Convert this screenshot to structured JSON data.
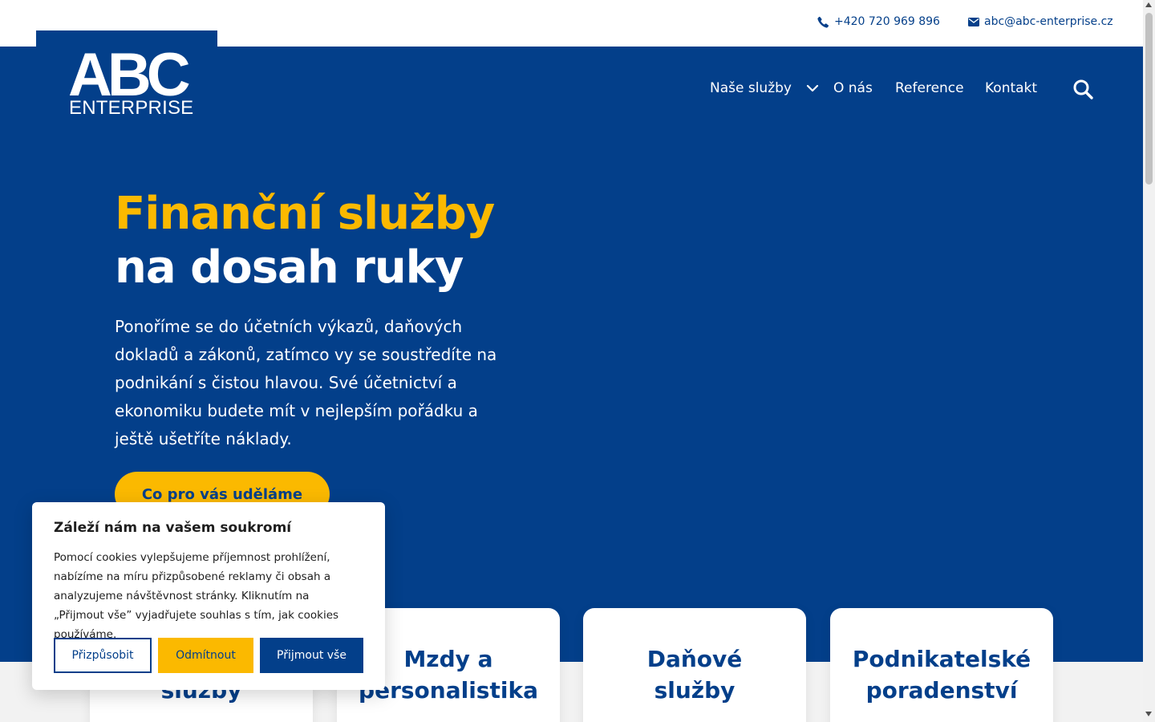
{
  "topbar": {
    "phone": "+420 720 969 896",
    "email": "abc@abc-enterprise.cz",
    "phone_icon": "phone-icon",
    "email_icon": "envelope-icon"
  },
  "logo": {
    "main": "ABC",
    "sub": "ENTERPRISE"
  },
  "nav": {
    "items": [
      {
        "label": "Naše služby",
        "has_dropdown": true
      },
      {
        "label": "O nás"
      },
      {
        "label": "Reference"
      },
      {
        "label": "Kontakt"
      }
    ],
    "search_icon": "search-icon"
  },
  "hero": {
    "title_line1": "Finanční služby",
    "title_line2": "na dosah ruky",
    "text": "Ponoříme se do účetních výkazů, daňových dokladů a zákonů, zatímco vy se soustředíte na podnikání s čistou hlavou. Své účetnictví a ekonomiku budete mít v nejlepším pořádku a ještě ušetříte náklady.",
    "cta_label": "Co pro vás uděláme"
  },
  "cards": [
    {
      "title": "služby"
    },
    {
      "title": "Mzdy a personalistika"
    },
    {
      "title": "Daňové služby"
    },
    {
      "title": "Podnikatelské poradenství"
    }
  ],
  "cookie": {
    "title": "Záleží nám na vašem soukromí",
    "text": "Pomocí cookies vylepšujeme příjemnost prohlížení, nabízíme na míru přizpůsobené reklamy či obsah a analyzujeme návštěvnost stránky. Kliknutím na „Přijmout vše” vyjadřujete souhlas s tím, jak cookies používáme.",
    "btn_customize": "Přizpůsobit",
    "btn_reject": "Odmítnout",
    "btn_accept": "Přijmout vše"
  },
  "colors": {
    "brand_blue": "#033f8a",
    "accent_yellow": "#fbb900",
    "white": "#ffffff"
  }
}
